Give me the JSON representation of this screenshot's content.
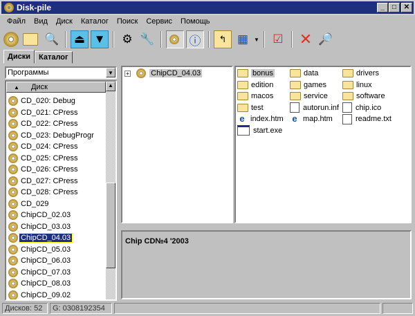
{
  "window": {
    "title": "Disk-pile"
  },
  "menu": [
    "Файл",
    "Вид",
    "Диск",
    "Каталог",
    "Поиск",
    "Сервис",
    "Помощь"
  ],
  "tabs": [
    "Диски",
    "Каталог"
  ],
  "category_select": "Программы",
  "list_header": "Диск",
  "disks": [
    "CD_020: Debug",
    "CD_021: CPress",
    "CD_022: CPress",
    "CD_023: DebugProgr",
    "CD_024: CPress",
    "CD_025: CPress",
    "CD_026: CPress",
    "CD_027: CPress",
    "CD_028: CPress",
    "CD_029",
    "ChipCD_02.03",
    "ChipCD_03.03",
    "ChipCD_04.03",
    "ChipCD_05.03",
    "ChipCD_06.03",
    "ChipCD_07.03",
    "ChipCD_08.03",
    "ChipCD_09.02"
  ],
  "selected_disk": "ChipCD_04.03",
  "tree": {
    "expander": "+",
    "root": "ChipCD_04.03"
  },
  "files": [
    {
      "name": "bonus",
      "type": "folder"
    },
    {
      "name": "data",
      "type": "folder"
    },
    {
      "name": "drivers",
      "type": "folder"
    },
    {
      "name": "edition",
      "type": "folder"
    },
    {
      "name": "games",
      "type": "folder"
    },
    {
      "name": "linux",
      "type": "folder"
    },
    {
      "name": "macos",
      "type": "folder"
    },
    {
      "name": "service",
      "type": "folder"
    },
    {
      "name": "software",
      "type": "folder"
    },
    {
      "name": "test",
      "type": "folder"
    },
    {
      "name": "autorun.inf",
      "type": "file"
    },
    {
      "name": "chip.ico",
      "type": "file"
    },
    {
      "name": "index.htm",
      "type": "html"
    },
    {
      "name": "map.htm",
      "type": "html"
    },
    {
      "name": "readme.txt",
      "type": "file"
    },
    {
      "name": "start.exe",
      "type": "exe"
    }
  ],
  "info": "Chip CD№4 '2003",
  "status": {
    "disks": "Дисков: 52",
    "serial": "G: 0308192354"
  }
}
